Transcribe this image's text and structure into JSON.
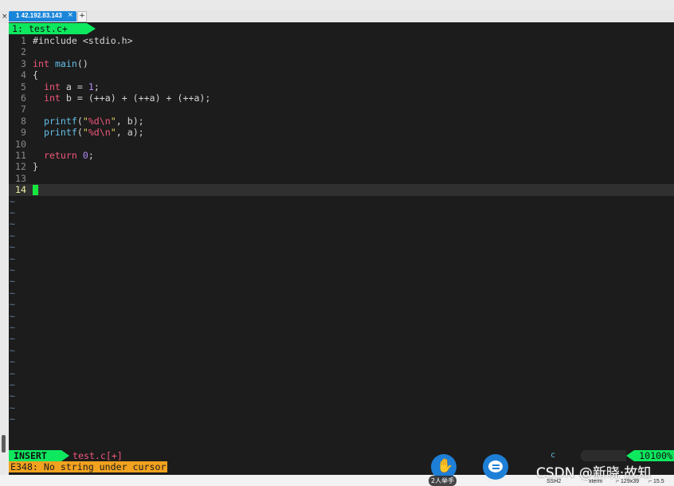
{
  "window": {
    "tab_title": "1 42.192.83.143",
    "tab_close": "×",
    "strip_close": "×",
    "new_tab": "+"
  },
  "editor": {
    "buffer_tab": "1: test.c+",
    "lines": [
      {
        "n": "1",
        "tokens": [
          {
            "t": "#include <stdio.h>",
            "c": "pp"
          }
        ]
      },
      {
        "n": "2",
        "tokens": []
      },
      {
        "n": "3",
        "tokens": [
          {
            "t": "int",
            "c": "kw"
          },
          {
            "t": " ",
            "c": ""
          },
          {
            "t": "main",
            "c": "fn"
          },
          {
            "t": "()",
            "c": ""
          }
        ]
      },
      {
        "n": "4",
        "tokens": [
          {
            "t": "{",
            "c": ""
          }
        ]
      },
      {
        "n": "5",
        "tokens": [
          {
            "t": "  ",
            "c": ""
          },
          {
            "t": "int",
            "c": "kw"
          },
          {
            "t": " a = ",
            "c": ""
          },
          {
            "t": "1",
            "c": "num"
          },
          {
            "t": ";",
            "c": ""
          }
        ]
      },
      {
        "n": "6",
        "tokens": [
          {
            "t": "  ",
            "c": ""
          },
          {
            "t": "int",
            "c": "kw"
          },
          {
            "t": " b = (++a) + (++a) + (++a);",
            "c": ""
          }
        ]
      },
      {
        "n": "7",
        "tokens": []
      },
      {
        "n": "8",
        "tokens": [
          {
            "t": "  ",
            "c": ""
          },
          {
            "t": "printf",
            "c": "fn"
          },
          {
            "t": "(",
            "c": ""
          },
          {
            "t": "\"",
            "c": "str"
          },
          {
            "t": "%d",
            "c": "spec"
          },
          {
            "t": "\\n",
            "c": "spec"
          },
          {
            "t": "\"",
            "c": "str"
          },
          {
            "t": ", b);",
            "c": ""
          }
        ]
      },
      {
        "n": "9",
        "tokens": [
          {
            "t": "  ",
            "c": ""
          },
          {
            "t": "printf",
            "c": "fn"
          },
          {
            "t": "(",
            "c": ""
          },
          {
            "t": "\"",
            "c": "str"
          },
          {
            "t": "%d",
            "c": "spec"
          },
          {
            "t": "\\n",
            "c": "spec"
          },
          {
            "t": "\"",
            "c": "str"
          },
          {
            "t": ", a);",
            "c": ""
          }
        ]
      },
      {
        "n": "10",
        "tokens": []
      },
      {
        "n": "11",
        "tokens": [
          {
            "t": "  ",
            "c": ""
          },
          {
            "t": "return",
            "c": "kw"
          },
          {
            "t": " ",
            "c": ""
          },
          {
            "t": "0",
            "c": "num"
          },
          {
            "t": ";",
            "c": ""
          }
        ]
      },
      {
        "n": "12",
        "tokens": [
          {
            "t": "}",
            "c": ""
          }
        ]
      },
      {
        "n": "13",
        "tokens": []
      },
      {
        "n": "14",
        "tokens": [],
        "cursor": true
      }
    ],
    "tilde_count": 20,
    "tilde_char": "~"
  },
  "statusline": {
    "mode": "INSERT",
    "filename": "test.c[+]",
    "filetype": "c",
    "position": "10100%"
  },
  "message": "E348: No string under cursor",
  "bottom_bar": {
    "items": [
      "SSH2",
      "xterm",
      "⌐ 129x39",
      "⌐ 15.5"
    ]
  },
  "overlay": {
    "hand_label": "2人举手",
    "watermark": "CSDN @新晓·故知"
  },
  "colors": {
    "accent_green": "#0ee85f",
    "keyword": "#f0577a",
    "function": "#64bfe7",
    "string": "#e0d562",
    "number": "#b38cf5",
    "error_bg": "#f2a21f"
  }
}
